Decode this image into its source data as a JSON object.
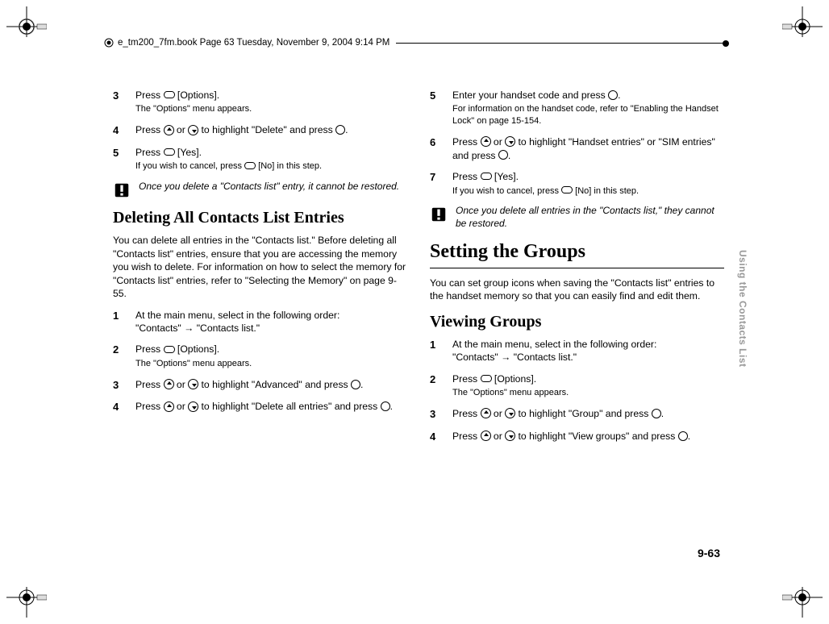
{
  "header": "e_tm200_7fm.book  Page 63  Tuesday, November 9, 2004  9:14 PM",
  "pagenum": "9-63",
  "sidetab": "Using the Contacts List",
  "left": {
    "s3": {
      "main": "Press ⌀ [Options].",
      "pre": "Press ",
      "opt": " [Options].",
      "sub": "The \"Options\" menu appears."
    },
    "s4": {
      "pre": "Press ",
      "mid": " or ",
      "post": " to highlight \"Delete\" and press ",
      "end": "."
    },
    "s5": {
      "pre": "Press ",
      "opt": " [Yes].",
      "sub_pre": "If you wish to cancel, press ",
      "sub_post": " [No] in this step."
    },
    "note1": "Once you delete a \"Contacts list\" entry, it cannot be restored.",
    "h2a": "Deleting All Contacts List Entries",
    "para1": "You can delete all entries in the \"Contacts list.\" Before deleting all \"Contacts list\" entries, ensure that you are accessing the memory you wish to delete. For information on how to select the memory for \"Contacts list\" entries, refer to \"Selecting the Memory\" on page 9-55.",
    "b1": {
      "line1": "At the main menu, select in the following order:",
      "line2_pre": "\"Contacts\" ",
      "line2_post": " \"Contacts list.\""
    },
    "b2": {
      "pre": "Press ",
      "opt": " [Options].",
      "sub": "The \"Options\" menu appears."
    },
    "b3": {
      "pre": "Press ",
      "mid": " or ",
      "post": " to highlight \"Advanced\" and press ",
      "end": "."
    },
    "b4": {
      "pre": "Press ",
      "mid": " or ",
      "post": " to highlight \"Delete all entries\" and press ",
      "end": "."
    }
  },
  "right": {
    "s5": {
      "pre": "Enter your handset code and press ",
      "end": ".",
      "sub": "For information on the handset code, refer to \"Enabling the Handset Lock\" on page 15-154."
    },
    "s6": {
      "pre": "Press ",
      "mid": " or ",
      "post": " to highlight \"Handset entries\" or \"SIM entries\" and press ",
      "end": "."
    },
    "s7": {
      "pre": "Press ",
      "opt": " [Yes].",
      "sub_pre": "If you wish to cancel, press ",
      "sub_post": " [No] in this step."
    },
    "note2": "Once you delete all entries in the \"Contacts list,\" they cannot be restored.",
    "h1": "Setting the Groups",
    "para2": "You can set group icons when saving the \"Contacts list\" entries to the handset memory so that you can easily find and edit them.",
    "h2b": "Viewing Groups",
    "c1": {
      "line1": "At the main menu, select in the following order:",
      "line2_pre": "\"Contacts\" ",
      "line2_post": " \"Contacts list.\""
    },
    "c2": {
      "pre": "Press ",
      "opt": " [Options].",
      "sub": "The \"Options\" menu appears."
    },
    "c3": {
      "pre": "Press ",
      "mid": " or ",
      "post": " to highlight \"Group\" and press ",
      "end": "."
    },
    "c4": {
      "pre": "Press ",
      "mid": " or ",
      "post": " to highlight \"View groups\" and press ",
      "end": "."
    }
  },
  "nums": {
    "n1": "1",
    "n2": "2",
    "n3": "3",
    "n4": "4",
    "n5": "5",
    "n6": "6",
    "n7": "7"
  },
  "arrow": "→"
}
